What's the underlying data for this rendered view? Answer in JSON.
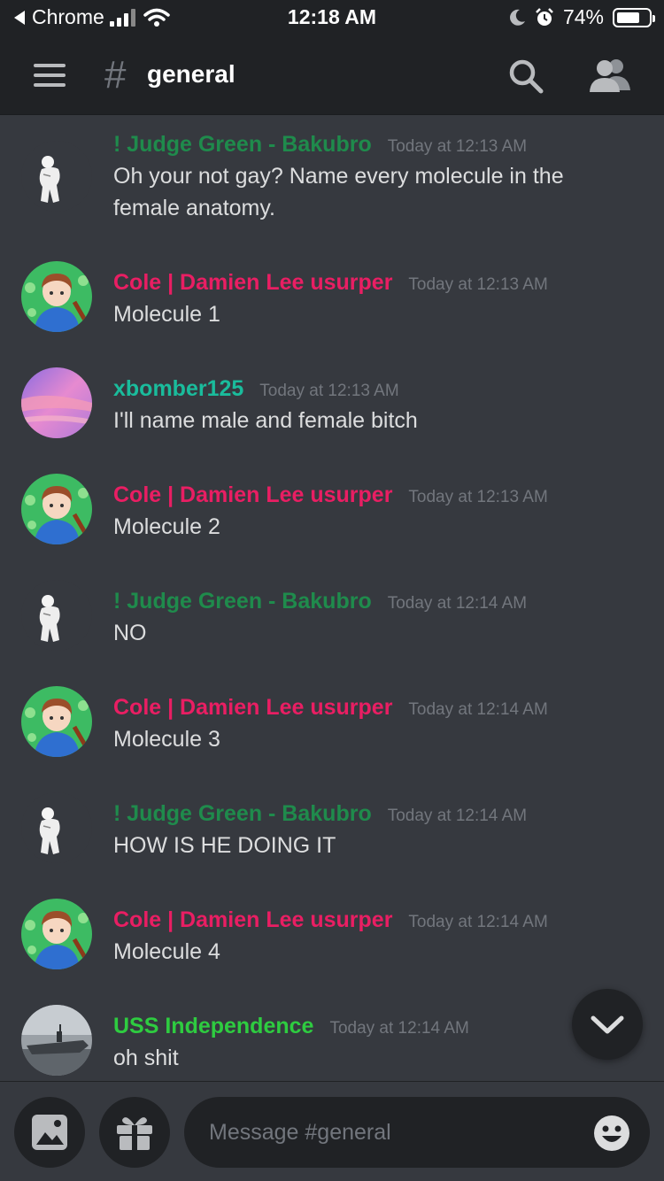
{
  "status_bar": {
    "back_app": "Chrome",
    "time": "12:18 AM",
    "battery_percent": "74%",
    "battery_level": 0.74
  },
  "header": {
    "channel_hash": "#",
    "channel_name": "general"
  },
  "users": {
    "judge": {
      "name": "! Judge Green - Bakubro",
      "color": "#1f8b4c"
    },
    "cole": {
      "name": "Cole | Damien Lee usurper",
      "color": "#e91e63"
    },
    "xbomber": {
      "name": "xbomber125",
      "color": "#1abc9c"
    },
    "uss": {
      "name": "USS Independence",
      "color": "#2ecc40"
    }
  },
  "messages": [
    {
      "user": "! Judge Green - Bakubro",
      "timestamp": "Today at 12:13 AM",
      "text": "Oh your not gay? Name every molecule in the female anatomy."
    },
    {
      "user": "Cole | Damien Lee usurper",
      "timestamp": "Today at 12:13 AM",
      "text": "Molecule 1"
    },
    {
      "user": "xbomber125",
      "timestamp": "Today at 12:13 AM",
      "text": "I'll name male and female bitch"
    },
    {
      "user": "Cole | Damien Lee usurper",
      "timestamp": "Today at 12:13 AM",
      "text": "Molecule 2"
    },
    {
      "user": "! Judge Green - Bakubro",
      "timestamp": "Today at 12:14 AM",
      "text": "NO"
    },
    {
      "user": "Cole | Damien Lee usurper",
      "timestamp": "Today at 12:14 AM",
      "text": "Molecule 3"
    },
    {
      "user": "! Judge Green - Bakubro",
      "timestamp": "Today at 12:14 AM",
      "text": "HOW IS HE DOING IT"
    },
    {
      "user": "Cole | Damien Lee usurper",
      "timestamp": "Today at 12:14 AM",
      "text": "Molecule 4"
    },
    {
      "user": "USS Independence",
      "timestamp": "Today at 12:14 AM",
      "text": "oh shit"
    }
  ],
  "composer": {
    "placeholder": "Message #general"
  },
  "icons": {
    "back": "back-arrow-icon",
    "signal": "cellular-signal-icon",
    "wifi": "wifi-icon",
    "moon": "do-not-disturb-icon",
    "alarm": "alarm-icon",
    "menu": "hamburger-menu-icon",
    "search": "search-icon",
    "members": "members-icon",
    "jump": "chevron-down-icon",
    "image": "image-icon",
    "gift": "gift-icon",
    "emoji": "emoji-icon"
  },
  "colors": {
    "background": "#36393f",
    "header": "#202225",
    "timestamp": "#72767d",
    "text": "#dcddde"
  }
}
